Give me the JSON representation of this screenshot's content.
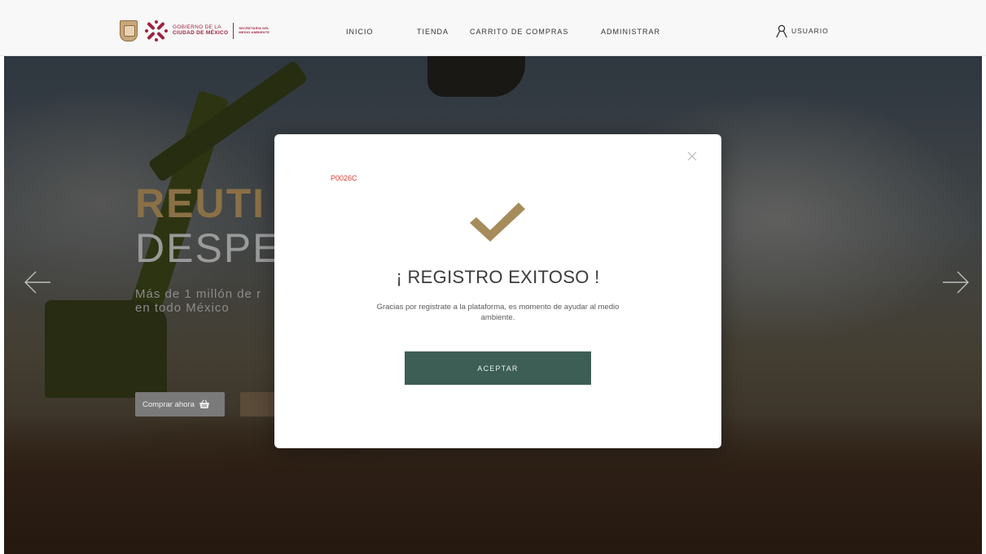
{
  "header": {
    "logo": {
      "gov_line1": "GOBIERNO DE LA",
      "gov_line2": "CIUDAD DE MÉXICO",
      "sec_line1": "SECRETARÍA DEL",
      "sec_line2": "MEDIO AMBIENTE"
    },
    "nav": {
      "inicio": "INICIO",
      "tienda": "TIENDA",
      "carrito": "CARRITO DE COMPRAS",
      "administrar": "ADMINISTRAR"
    },
    "user": {
      "label": "USUARIO",
      "icon": "user-icon"
    }
  },
  "hero": {
    "title_line1": "REUTI",
    "title_line2": "DESPE",
    "subtitle_line1": "Más de 1 millón de r",
    "subtitle_line2": "en todo México",
    "buy_button": {
      "label": "Comprar ahora",
      "icon": "basket-icon"
    },
    "arrows": {
      "left": "arrow-left-icon",
      "right": "arrow-right-icon"
    }
  },
  "modal": {
    "code": "P0026C",
    "close_icon": "close-icon",
    "success_icon": "checkmark-icon",
    "title": "¡ REGISTRO EXITOSO !",
    "message": "Gracias por registrate a la plataforma, es momento de ayudar al medio ambiente.",
    "accept_label": "ACEPTAR"
  },
  "colors": {
    "brand_wine": "#9f2241",
    "accent_gold": "#a68b5b",
    "button_green": "#3d5e55",
    "code_red": "#e03a2f"
  }
}
